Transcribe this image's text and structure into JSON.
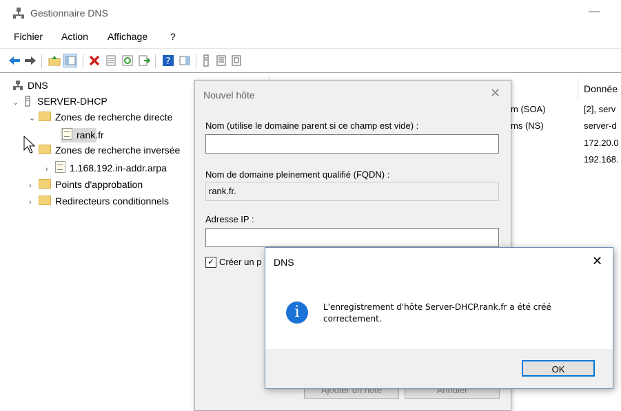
{
  "window": {
    "title": "Gestionnaire DNS",
    "minimize_glyph": "—"
  },
  "menu": [
    "Fichier",
    "Action",
    "Affichage",
    "?"
  ],
  "toolbar_icons": [
    "back-arrow-icon",
    "forward-arrow-icon",
    "up-folder-icon",
    "show-hide-console-tree-icon",
    "delete-icon",
    "properties-icon",
    "refresh-icon",
    "export-icon",
    "help-icon",
    "action-pane-icon",
    "server-icon",
    "list-icon",
    "record-icon"
  ],
  "tree": {
    "root": "DNS",
    "server": "SERVER-DHCP",
    "items": [
      "Zones de recherche directe",
      "rank.fr",
      "Zones de recherche inversée",
      "1.168.192.in-addr.arpa",
      "Points d'approbation",
      "Redirecteurs conditionnels"
    ]
  },
  "right_pane": {
    "col_header": "Donnée",
    "type_cells": [
      "m (SOA)",
      "ms (NS)"
    ],
    "data_cells": [
      "[2], serv",
      "server-d",
      "172.20.0",
      "192.168."
    ]
  },
  "new_host_dialog": {
    "title": "Nouvel hôte",
    "name_label": "Nom (utilise le domaine parent si ce champ est vide) :",
    "name_value": "",
    "fqdn_label": "Nom de domaine pleinement qualifié (FQDN) :",
    "fqdn_value": "rank.fr.",
    "ip_label": "Adresse IP :",
    "ip_value": "",
    "checkbox_label": "Créer un p",
    "checkbox_checked": "✓",
    "add_button": "Ajouter un hôte",
    "cancel_button": "Annuler"
  },
  "message_box": {
    "title": "DNS",
    "icon": "i",
    "text": "L'enregistrement d'hôte Server-DHCP.rank.fr a été créé correctement.",
    "ok_button": "OK"
  }
}
